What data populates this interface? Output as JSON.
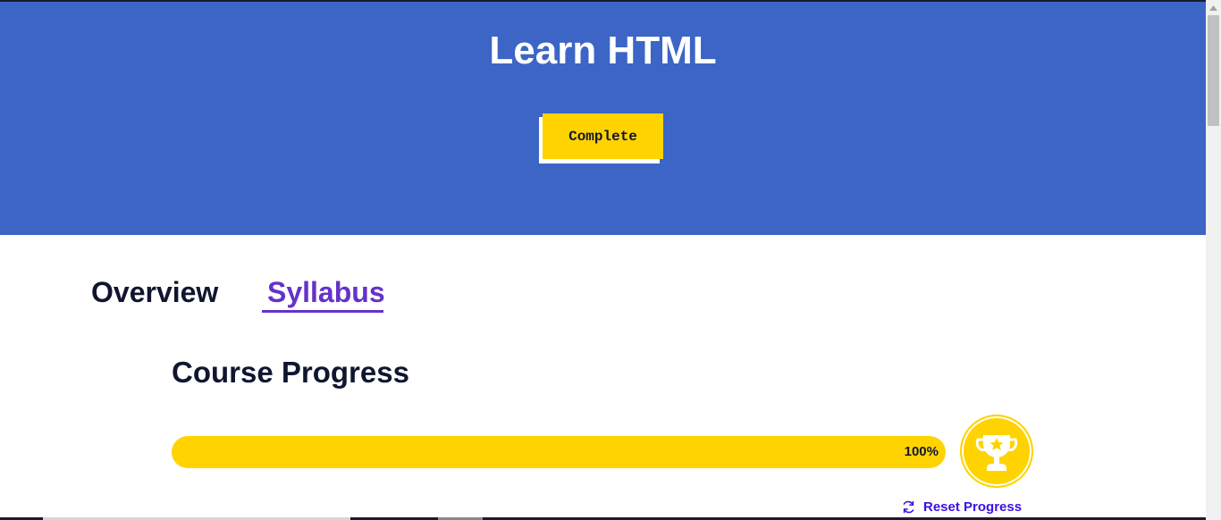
{
  "hero": {
    "title": "Learn HTML",
    "button_label": "Complete",
    "background_color": "#3c65c6",
    "button_color": "#ffd300"
  },
  "tabs": [
    {
      "label": "Overview",
      "active": false
    },
    {
      "label": "Syllabus",
      "active": true
    }
  ],
  "progress": {
    "title": "Course Progress",
    "percent_label": "100%",
    "fraction": 1.0,
    "fill_color": "#ffd300",
    "badge_icon": "trophy-icon"
  },
  "reset": {
    "label": "Reset Progress",
    "icon": "refresh-icon",
    "color": "#3a10e5"
  }
}
